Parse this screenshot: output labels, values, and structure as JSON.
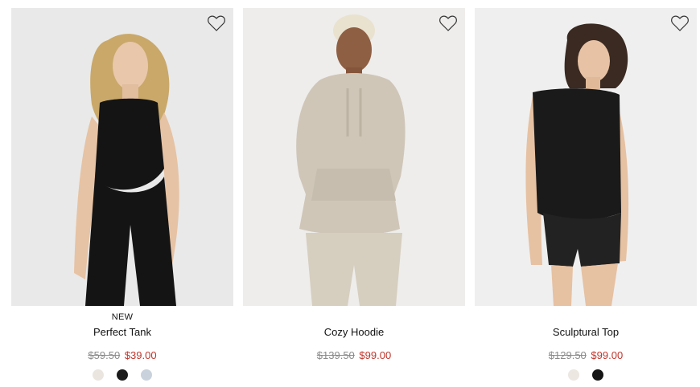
{
  "products": [
    {
      "badge": "NEW",
      "name": "Perfect Tank",
      "original_price": "$59.50",
      "sale_price": "$39.00",
      "photo_bg": "#eaeaea",
      "garment_color": "#141414",
      "swatches": [
        {
          "color": "#eae6df"
        },
        {
          "color": "#1b1b1b"
        },
        {
          "color": "#c9d2dc"
        }
      ]
    },
    {
      "badge": "",
      "name": "Cozy Hoodie",
      "original_price": "$139.50",
      "sale_price": "$99.00",
      "photo_bg": "#eeedeb",
      "garment_color": "#cfc6b8",
      "swatches": []
    },
    {
      "badge": "",
      "name": "Sculptural Top",
      "original_price": "$129.50",
      "sale_price": "$99.00",
      "photo_bg": "#efefef",
      "garment_color": "#1a1a1a",
      "swatches": [
        {
          "color": "#ece7e1"
        },
        {
          "color": "#151515"
        }
      ]
    }
  ],
  "colors": {
    "sale_price": "#c0352b",
    "original_price": "#8a8a8a"
  }
}
